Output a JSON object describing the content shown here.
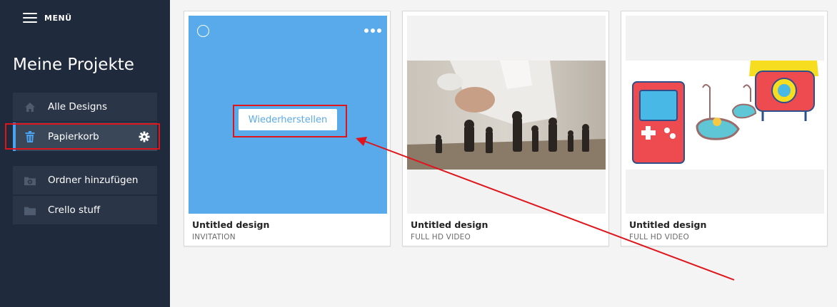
{
  "sidebar": {
    "menu_label": "MENÜ",
    "title": "Meine Projekte",
    "items": [
      {
        "label": "Alle Designs",
        "icon": "home-icon"
      },
      {
        "label": "Papierkorb",
        "icon": "trash-icon",
        "active": true
      },
      {
        "label": "Ordner hinzufügen",
        "icon": "folder-add-icon"
      },
      {
        "label": "Crello stuff",
        "icon": "folder-icon"
      }
    ]
  },
  "cards": [
    {
      "title": "Untitled design",
      "type": "INVITATION",
      "action_label": "Wiederherstellen",
      "thumb_color": "#58aaea"
    },
    {
      "title": "Untitled design",
      "type": "FULL HD VIDEO",
      "thumb": "chess-photo"
    },
    {
      "title": "Untitled design",
      "type": "FULL HD VIDEO",
      "thumb": "retro-illustration"
    }
  ],
  "colors": {
    "sidebar_bg": "#1f2a3c",
    "accent": "#4aa3f0",
    "highlight": "#e0141b"
  }
}
